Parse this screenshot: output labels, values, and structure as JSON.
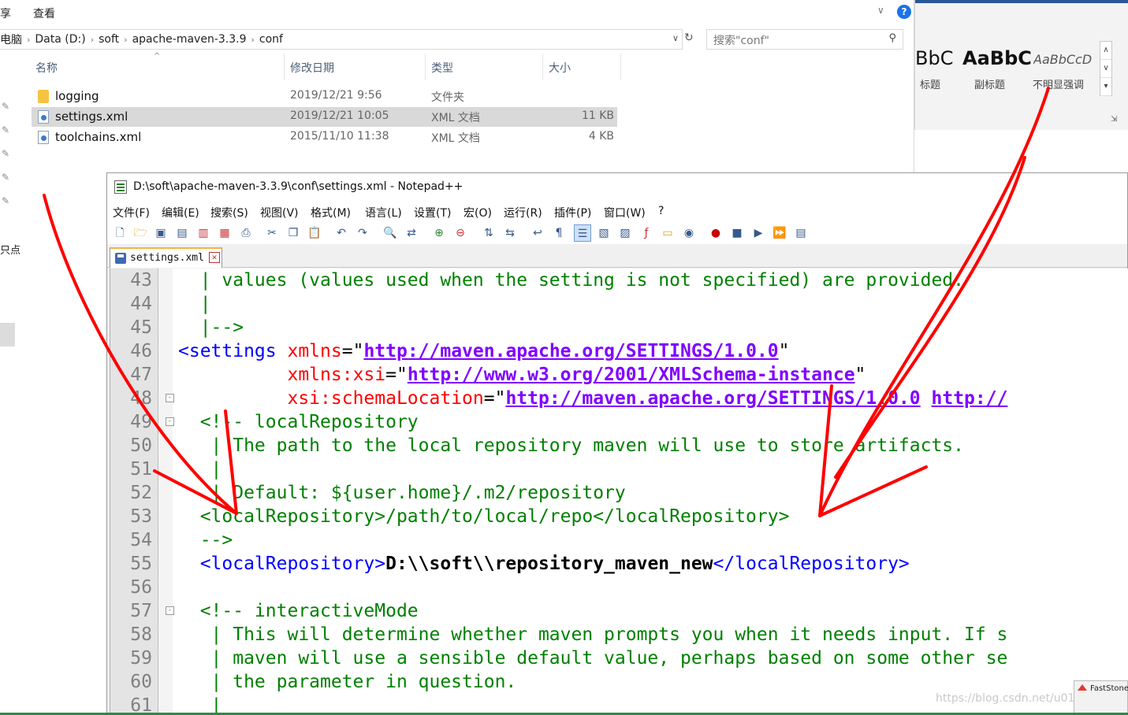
{
  "explorer": {
    "ribbon_tabs": [
      "享",
      "查看"
    ],
    "breadcrumb": [
      "电脑",
      "Data (D:)",
      "soft",
      "apache-maven-3.3.9",
      "conf"
    ],
    "search_placeholder": "搜索\"conf\"",
    "columns": [
      "名称",
      "修改日期",
      "类型",
      "大小"
    ],
    "files": [
      {
        "name": "logging",
        "date": "2019/12/21 9:56",
        "type": "文件夹",
        "size": "",
        "kind": "folder",
        "selected": false
      },
      {
        "name": "settings.xml",
        "date": "2019/12/21 10:05",
        "type": "XML 文档",
        "size": "11 KB",
        "kind": "xml",
        "selected": true
      },
      {
        "name": "toolchains.xml",
        "date": "2015/11/10 11:38",
        "type": "XML 文档",
        "size": "4 KB",
        "kind": "xml",
        "selected": false
      }
    ],
    "left_label": "只点",
    "help_glyph": "?",
    "collapse_glyph": "∨"
  },
  "word_styles": {
    "items": [
      {
        "sample": "BbC",
        "name": "标题"
      },
      {
        "sample": "AaBbC",
        "name": "副标题"
      },
      {
        "sample": "AaBbCcD",
        "name": "不明显强调"
      }
    ]
  },
  "npp": {
    "title": "D:\\soft\\apache-maven-3.3.9\\conf\\settings.xml - Notepad++",
    "menu": [
      "文件(F)",
      "编辑(E)",
      "搜索(S)",
      "视图(V)",
      "格式(M)",
      "语言(L)",
      "设置(T)",
      "宏(O)",
      "运行(R)",
      "插件(P)",
      "窗口(W)",
      "?"
    ],
    "tab_label": "settings.xml",
    "lines": [
      {
        "n": "43",
        "fold": "",
        "segs": [
          [
            "c-com",
            "  | values (values used when the setting is not specified) are provided."
          ]
        ]
      },
      {
        "n": "44",
        "fold": "",
        "segs": [
          [
            "c-com",
            "  |"
          ]
        ]
      },
      {
        "n": "45",
        "fold": "",
        "segs": [
          [
            "c-com",
            "  |-->"
          ]
        ]
      },
      {
        "n": "46",
        "fold": "",
        "segs": [
          [
            "c-tag",
            "<settings "
          ],
          [
            "c-attr",
            "xmlns"
          ],
          [
            "c-plain",
            "=\""
          ],
          [
            "c-url",
            "http://maven.apache.org/SETTINGS/1.0.0"
          ],
          [
            "c-plain",
            "\""
          ]
        ]
      },
      {
        "n": "47",
        "fold": "",
        "segs": [
          [
            "c-plain",
            "          "
          ],
          [
            "c-attr",
            "xmlns:xsi"
          ],
          [
            "c-plain",
            "=\""
          ],
          [
            "c-url",
            "http://www.w3.org/2001/XMLSchema-instance"
          ],
          [
            "c-plain",
            "\""
          ]
        ]
      },
      {
        "n": "48",
        "fold": "-",
        "segs": [
          [
            "c-plain",
            "          "
          ],
          [
            "c-attr",
            "xsi:schemaLocation"
          ],
          [
            "c-plain",
            "=\""
          ],
          [
            "c-url",
            "http://maven.apache.org/SETTINGS/1.0.0"
          ],
          [
            "c-plain",
            " "
          ],
          [
            "c-url",
            "http://"
          ]
        ]
      },
      {
        "n": "49",
        "fold": "-",
        "segs": [
          [
            "c-com",
            "  <!-- localRepository"
          ]
        ]
      },
      {
        "n": "50",
        "fold": "",
        "segs": [
          [
            "c-com",
            "   | The path to the local repository maven will use to store artifacts."
          ]
        ]
      },
      {
        "n": "51",
        "fold": "",
        "segs": [
          [
            "c-com",
            "   |"
          ]
        ]
      },
      {
        "n": "52",
        "fold": "",
        "segs": [
          [
            "c-com",
            "   | Default: ${user.home}/.m2/repository"
          ]
        ]
      },
      {
        "n": "53",
        "fold": "",
        "segs": [
          [
            "c-com",
            "  <localRepository>/path/to/local/repo</localRepository>"
          ]
        ]
      },
      {
        "n": "54",
        "fold": "",
        "segs": [
          [
            "c-com",
            "  -->"
          ]
        ]
      },
      {
        "n": "55",
        "fold": "",
        "segs": [
          [
            "c-plain",
            "  "
          ],
          [
            "c-tag",
            "<localRepository>"
          ],
          [
            "c-txt",
            "D:\\\\soft\\\\repository_maven_new"
          ],
          [
            "c-tag",
            "</localRepository>"
          ]
        ]
      },
      {
        "n": "56",
        "fold": "",
        "segs": [
          [
            "c-plain",
            ""
          ]
        ]
      },
      {
        "n": "57",
        "fold": "-",
        "segs": [
          [
            "c-com",
            "  <!-- interactiveMode"
          ]
        ]
      },
      {
        "n": "58",
        "fold": "",
        "segs": [
          [
            "c-com",
            "   | This will determine whether maven prompts you when it needs input. If s"
          ]
        ]
      },
      {
        "n": "59",
        "fold": "",
        "segs": [
          [
            "c-com",
            "   | maven will use a sensible default value, perhaps based on some other se"
          ]
        ]
      },
      {
        "n": "60",
        "fold": "",
        "segs": [
          [
            "c-com",
            "   | the parameter in question."
          ]
        ]
      },
      {
        "n": "61",
        "fold": "",
        "segs": [
          [
            "c-com",
            "   |"
          ]
        ]
      }
    ]
  },
  "watermark": "https://blog.csdn.net/u01",
  "faststone_label": "FastStone",
  "annotation_color": "#ff0000"
}
